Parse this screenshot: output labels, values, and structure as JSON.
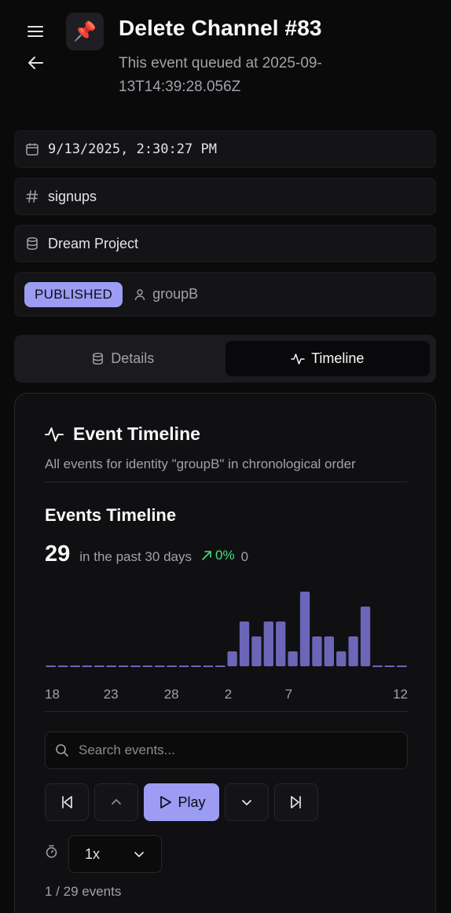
{
  "header": {
    "app_emoji": "📌",
    "title": "Delete Channel #83",
    "subtitle": "This event queued at 2025-09-13T14:39:28.056Z"
  },
  "info": {
    "timestamp": "9/13/2025, 2:30:27 PM",
    "channel": "signups",
    "project": "Dream Project",
    "status": "PUBLISHED",
    "group": "groupB"
  },
  "tabs": [
    {
      "label": "Details",
      "active": false
    },
    {
      "label": "Timeline",
      "active": true
    }
  ],
  "timeline": {
    "title": "Event Timeline",
    "description": "All events for identity \"groupB\" in chronological order",
    "section_title": "Events Timeline",
    "total": "29",
    "period_label": "in the past 30 days",
    "change": "0%",
    "change_base": "0",
    "search_placeholder": "Search events...",
    "play_label": "Play",
    "speed": "1x",
    "position_label": "1 / 29 events"
  },
  "chart_data": {
    "type": "bar",
    "x_tick_labels": [
      "18",
      "23",
      "28",
      "2",
      "7",
      "12"
    ],
    "values": [
      0,
      0,
      0,
      0,
      0,
      0,
      0,
      0,
      0,
      0,
      0,
      0,
      0,
      0,
      0,
      1,
      3,
      2,
      3,
      3,
      1,
      5,
      2,
      2,
      1,
      2,
      4,
      0,
      0,
      0
    ],
    "ylim": [
      0,
      5
    ],
    "color": "#6b66b8"
  },
  "colors": {
    "accent": "#9b9cf2",
    "positive": "#4ade80",
    "background": "#0a0a0b"
  }
}
